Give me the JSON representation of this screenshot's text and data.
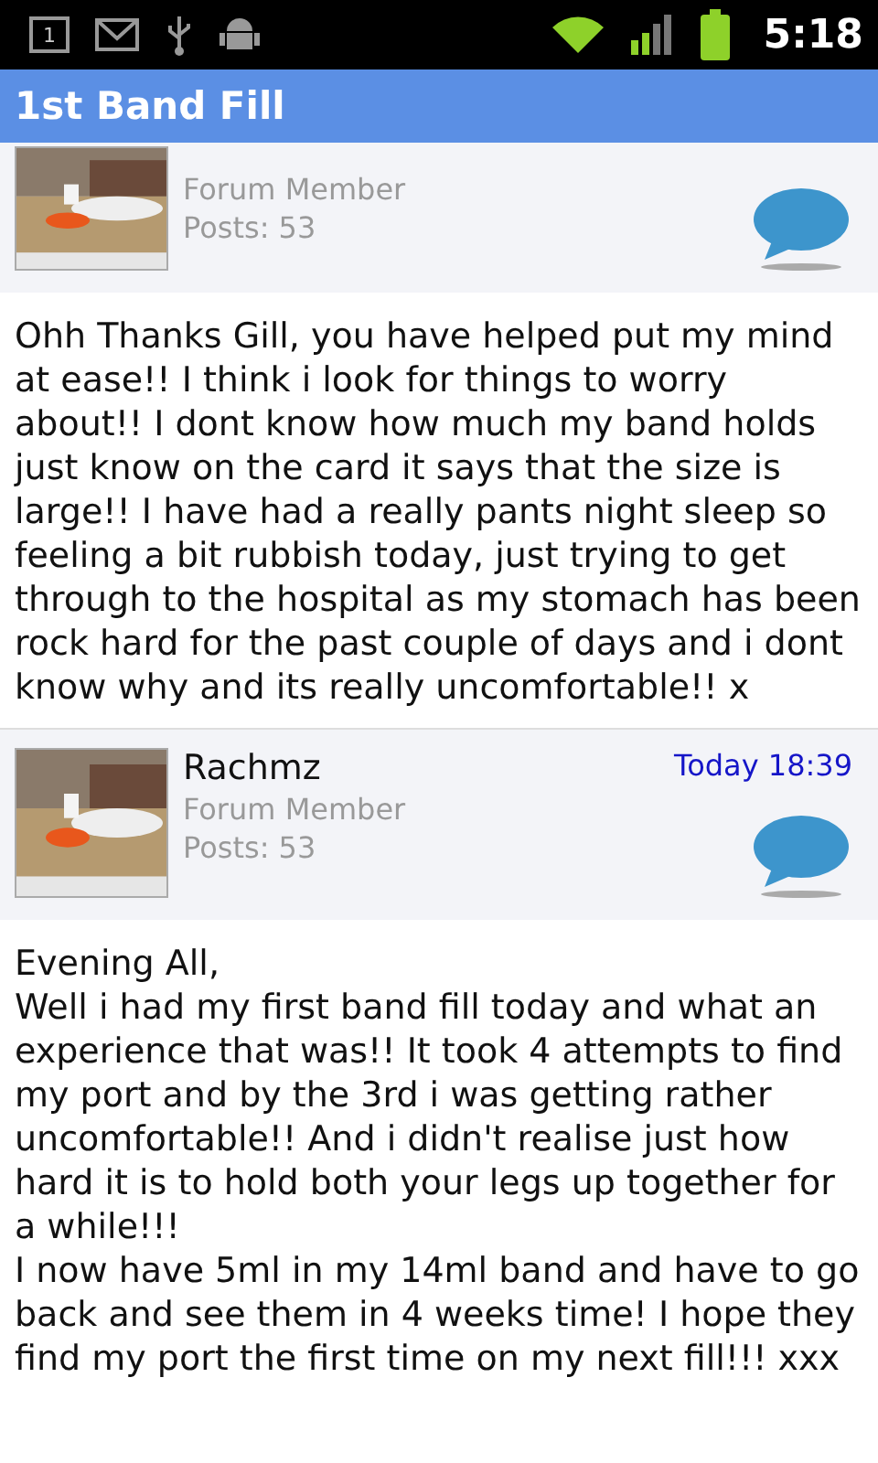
{
  "status_bar": {
    "time": "5:18",
    "notification_count": "1"
  },
  "title_bar": {
    "title": "1st Band Fill"
  },
  "posts": [
    {
      "role": "Forum Member",
      "posts": "Posts: 53",
      "body": [
        "Ohh Thanks Gill, you have helped put my mind at ease!! I think i look for things to worry about!! I dont know how much my band holds just know on the card it says that the size is large!! I have had a really pants night sleep so feeling a bit rubbish today, just trying to get through to the hospital as my stomach has been rock hard for the past couple of days and i dont know why and its really uncomfortable!! x"
      ]
    },
    {
      "author": "Rachmz",
      "role": "Forum Member",
      "posts": "Posts: 53",
      "date": "Today 18:39",
      "body": [
        "Evening All,",
        "Well i had my first band fill today and what an experience that was!! It took 4 attempts to find my port and by the 3rd i was getting rather uncomfortable!! And i didn't realise just how hard it is to hold both your legs up together for a while!!!",
        "I now have 5ml in my 14ml band and have to go back and see them in 4 weeks time! I hope they find my port the first time on my next fill!!! xxx"
      ]
    }
  ]
}
